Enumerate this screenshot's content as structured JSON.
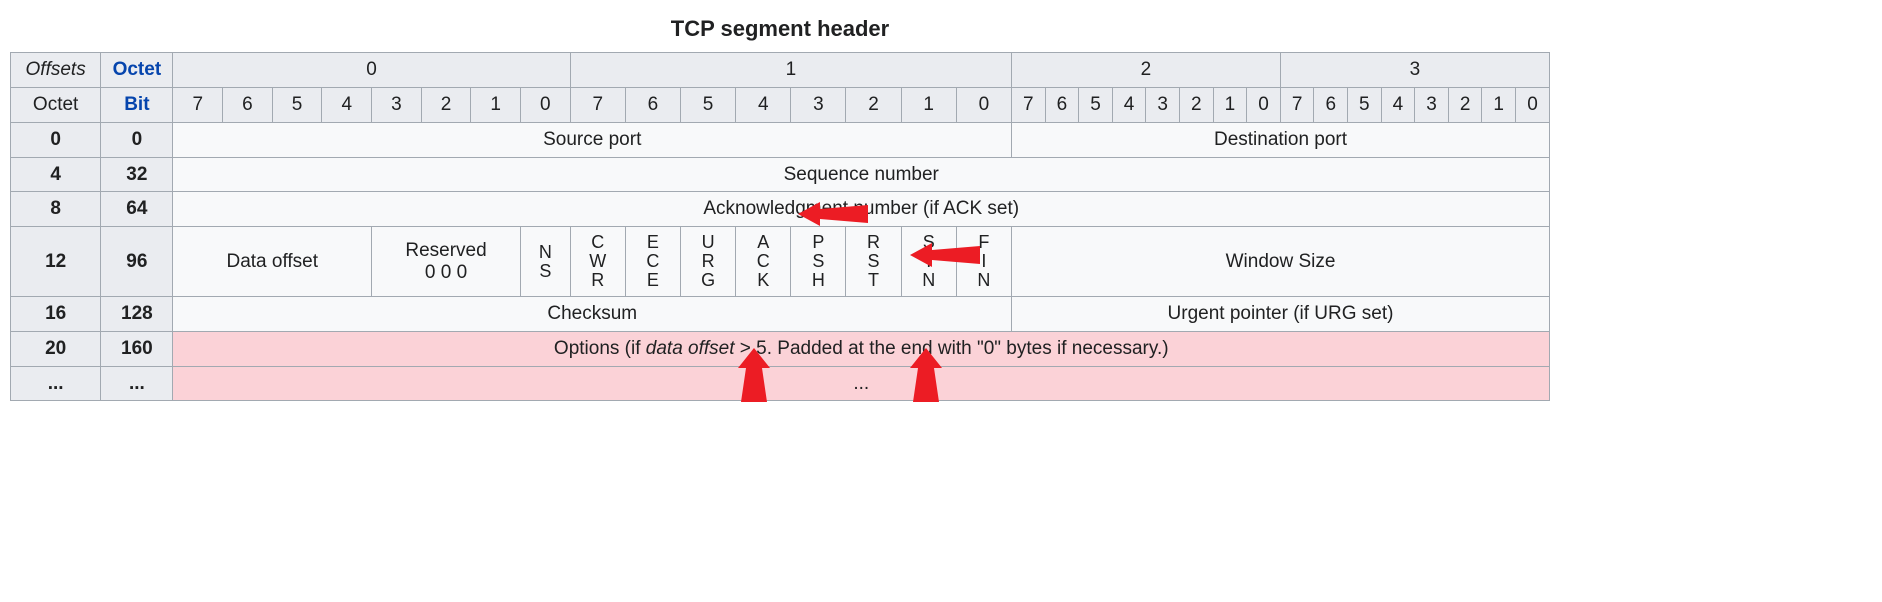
{
  "caption": "TCP segment header",
  "header": {
    "offsets": "Offsets",
    "octet_link": "Octet",
    "octet": "Octet",
    "bit_link": "Bit",
    "octets": [
      "0",
      "1",
      "2",
      "3"
    ],
    "bits": [
      "7",
      "6",
      "5",
      "4",
      "3",
      "2",
      "1",
      "0",
      "7",
      "6",
      "5",
      "4",
      "3",
      "2",
      "1",
      "0",
      "7",
      "6",
      "5",
      "4",
      "3",
      "2",
      "1",
      "0",
      "7",
      "6",
      "5",
      "4",
      "3",
      "2",
      "1",
      "0"
    ]
  },
  "rows": {
    "r0": {
      "octet": "0",
      "bit": "0",
      "src": "Source port",
      "dst": "Destination port"
    },
    "r4": {
      "octet": "4",
      "bit": "32",
      "seq": "Sequence number"
    },
    "r8": {
      "octet": "8",
      "bit": "64",
      "ack": "Acknowledgment number (if ACK set)"
    },
    "r12": {
      "octet": "12",
      "bit": "96",
      "data_offset": "Data offset",
      "reserved_label": "Reserved",
      "reserved_bits": "0 0 0",
      "flags": {
        "ns": "N\nS",
        "cwr": "C\nW\nR",
        "ece": "E\nC\nE",
        "urg": "U\nR\nG",
        "ack": "A\nC\nK",
        "psh": "P\nS\nH",
        "rst": "R\nS\nT",
        "syn": "S\nY\nN",
        "fin": "F\nI\nN"
      },
      "window": "Window Size"
    },
    "r16": {
      "octet": "16",
      "bit": "128",
      "checksum": "Checksum",
      "urgent": "Urgent pointer (if URG set)"
    },
    "r20": {
      "octet": "20",
      "bit": "160",
      "opts_pre": "Options (if ",
      "opts_em": "data offset",
      "opts_post": " > 5. Padded at the end with \"0\" bytes if necessary.)"
    },
    "rdots": {
      "octet": "...",
      "bit": "...",
      "body": "..."
    }
  }
}
